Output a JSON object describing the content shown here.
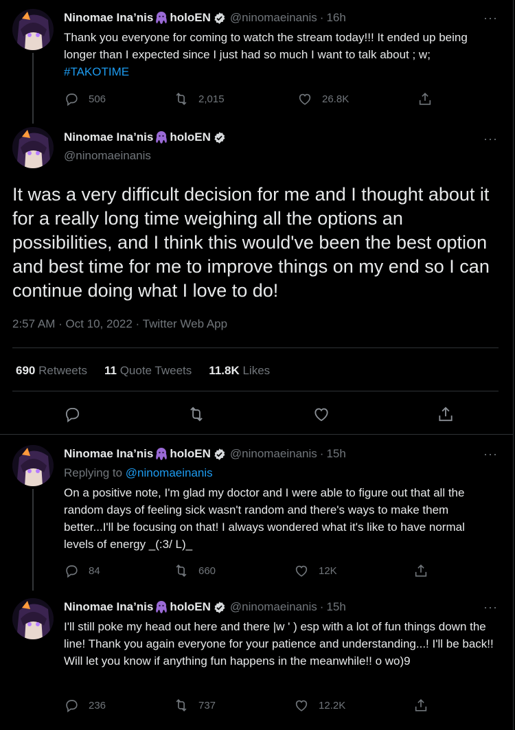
{
  "tweet1": {
    "name": "Ninomae Ina’nis",
    "name_suffix": "holoEN",
    "handle": "@ninomaeinanis",
    "time": "16h",
    "more": "···",
    "text": "Thank you everyone for coming to watch the stream today!!! It ended up being longer than I expected since I just had so much I want to talk about ; w; ",
    "hashtag": "#TAKOTIME",
    "replies": "506",
    "retweets": "2,015",
    "likes": "26.8K"
  },
  "main_tweet": {
    "name": "Ninomae Ina’nis",
    "name_suffix": "holoEN",
    "handle": "@ninomaeinanis",
    "more": "···",
    "text": "It was a very difficult decision for me and I thought about it for a really long time weighing all the options an possibilities, and I think this would've been the best option and best time for me to improve things on my end so I can continue doing what I love to do!",
    "timestamp": "2:57 AM · Oct 10, 2022 · Twitter Web App",
    "retweets_num": "690",
    "retweets_label": "Retweets",
    "quotes_num": "11",
    "quotes_label": "Quote Tweets",
    "likes_num": "11.8K",
    "likes_label": "Likes"
  },
  "tweet3": {
    "name": "Ninomae Ina’nis",
    "name_suffix": "holoEN",
    "handle": "@ninomaeinanis",
    "time": "15h",
    "more": "···",
    "replying_label": "Replying to ",
    "replying_handle": "@ninomaeinanis",
    "text": "On a positive note, I'm glad my doctor and I were able to figure out that all the random days of feeling sick wasn't random and there's ways to make them better...I'll be focusing on that! I always wondered what it's like to have normal levels of energy _(:3/ L)_",
    "replies": "84",
    "retweets": "660",
    "likes": "12K"
  },
  "tweet4": {
    "name": "Ninomae Ina’nis",
    "name_suffix": "holoEN",
    "handle": "@ninomaeinanis",
    "time": "15h",
    "more": "···",
    "text": "I'll still poke my head out here and there |w ' ) esp with a lot of fun things down the line! Thank you again everyone for your patience and understanding...! I'll be back!! Will let you know if anything fun happens in the meanwhile!! o wo)9",
    "replies": "236",
    "retweets": "737",
    "likes": "12.2K"
  },
  "colors": {
    "background": "#000000",
    "text": "#e7e9ea",
    "secondary": "#71767b",
    "link": "#1d9bf0",
    "octopus": "#9a6ad6"
  },
  "icons": {
    "reply": "reply-icon",
    "retweet": "retweet-icon",
    "like": "heart-icon",
    "share": "share-icon",
    "verified": "verified-badge-icon",
    "octopus": "octopus-emoji-icon"
  }
}
